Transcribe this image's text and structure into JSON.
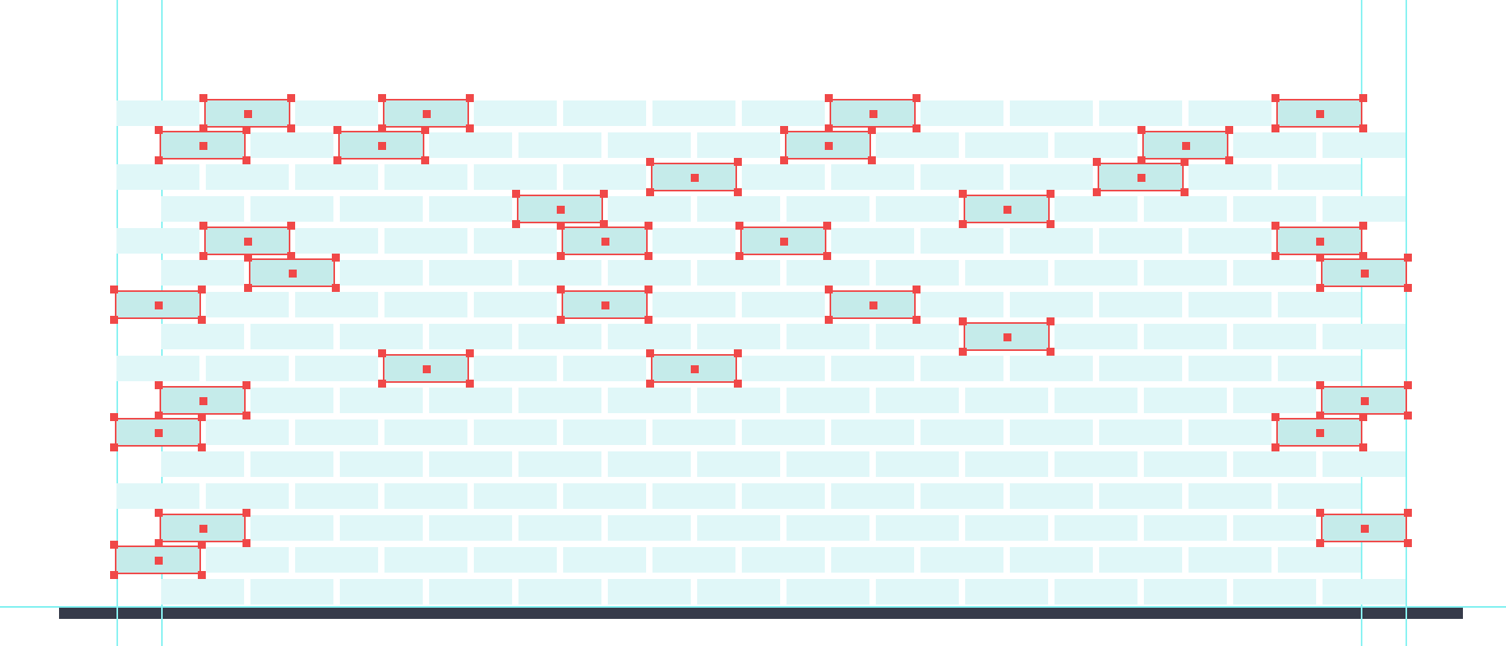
{
  "canvas": {
    "rows": [
      {
        "bricks": [
          {
            "selected": false
          },
          {
            "selected": true
          },
          {
            "selected": false
          },
          {
            "selected": true
          },
          {
            "selected": false
          },
          {
            "selected": false
          },
          {
            "selected": false
          },
          {
            "selected": false
          },
          {
            "selected": true
          },
          {
            "selected": false
          },
          {
            "selected": false
          },
          {
            "selected": false
          },
          {
            "selected": false
          },
          {
            "selected": true
          }
        ]
      },
      {
        "bricks": [
          {
            "selected": true
          },
          {
            "selected": false
          },
          {
            "selected": true
          },
          {
            "selected": false
          },
          {
            "selected": false
          },
          {
            "selected": false
          },
          {
            "selected": false
          },
          {
            "selected": true
          },
          {
            "selected": false
          },
          {
            "selected": false
          },
          {
            "selected": false
          },
          {
            "selected": true
          },
          {
            "selected": false
          },
          {
            "selected": false
          }
        ]
      },
      {
        "bricks": [
          {
            "selected": false
          },
          {
            "selected": false
          },
          {
            "selected": false
          },
          {
            "selected": false
          },
          {
            "selected": false
          },
          {
            "selected": false
          },
          {
            "selected": true
          },
          {
            "selected": false
          },
          {
            "selected": false
          },
          {
            "selected": false
          },
          {
            "selected": false
          },
          {
            "selected": true
          },
          {
            "selected": false
          },
          {
            "selected": false
          }
        ]
      },
      {
        "bricks": [
          {
            "selected": false
          },
          {
            "selected": false
          },
          {
            "selected": false
          },
          {
            "selected": false
          },
          {
            "selected": true
          },
          {
            "selected": false
          },
          {
            "selected": false
          },
          {
            "selected": false
          },
          {
            "selected": false
          },
          {
            "selected": true
          },
          {
            "selected": false
          },
          {
            "selected": false
          },
          {
            "selected": false
          },
          {
            "selected": false
          }
        ]
      },
      {
        "bricks": [
          {
            "selected": false
          },
          {
            "selected": true
          },
          {
            "selected": false
          },
          {
            "selected": false
          },
          {
            "selected": false
          },
          {
            "selected": true
          },
          {
            "selected": false
          },
          {
            "selected": true
          },
          {
            "selected": false
          },
          {
            "selected": false
          },
          {
            "selected": false
          },
          {
            "selected": false
          },
          {
            "selected": false
          },
          {
            "selected": true
          }
        ]
      },
      {
        "bricks": [
          {
            "selected": false
          },
          {
            "selected": true
          },
          {
            "selected": false
          },
          {
            "selected": false
          },
          {
            "selected": false
          },
          {
            "selected": false
          },
          {
            "selected": false
          },
          {
            "selected": false
          },
          {
            "selected": false
          },
          {
            "selected": false
          },
          {
            "selected": false
          },
          {
            "selected": false
          },
          {
            "selected": false
          },
          {
            "selected": true
          }
        ]
      },
      {
        "bricks": [
          {
            "selected": true
          },
          {
            "selected": false
          },
          {
            "selected": false
          },
          {
            "selected": false
          },
          {
            "selected": false
          },
          {
            "selected": true
          },
          {
            "selected": false
          },
          {
            "selected": false
          },
          {
            "selected": true
          },
          {
            "selected": false
          },
          {
            "selected": false
          },
          {
            "selected": false
          },
          {
            "selected": false
          },
          {
            "selected": false
          }
        ]
      },
      {
        "bricks": [
          {
            "selected": false
          },
          {
            "selected": false
          },
          {
            "selected": false
          },
          {
            "selected": false
          },
          {
            "selected": false
          },
          {
            "selected": false
          },
          {
            "selected": false
          },
          {
            "selected": false
          },
          {
            "selected": false
          },
          {
            "selected": true
          },
          {
            "selected": false
          },
          {
            "selected": false
          },
          {
            "selected": false
          },
          {
            "selected": false
          }
        ]
      },
      {
        "bricks": [
          {
            "selected": false
          },
          {
            "selected": false
          },
          {
            "selected": false
          },
          {
            "selected": true
          },
          {
            "selected": false
          },
          {
            "selected": false
          },
          {
            "selected": true
          },
          {
            "selected": false
          },
          {
            "selected": false
          },
          {
            "selected": false
          },
          {
            "selected": false
          },
          {
            "selected": false
          },
          {
            "selected": false
          },
          {
            "selected": false
          }
        ]
      },
      {
        "bricks": [
          {
            "selected": true
          },
          {
            "selected": false
          },
          {
            "selected": false
          },
          {
            "selected": false
          },
          {
            "selected": false
          },
          {
            "selected": false
          },
          {
            "selected": false
          },
          {
            "selected": false
          },
          {
            "selected": false
          },
          {
            "selected": false
          },
          {
            "selected": false
          },
          {
            "selected": false
          },
          {
            "selected": false
          },
          {
            "selected": true
          }
        ]
      },
      {
        "bricks": [
          {
            "selected": true
          },
          {
            "selected": false
          },
          {
            "selected": false
          },
          {
            "selected": false
          },
          {
            "selected": false
          },
          {
            "selected": false
          },
          {
            "selected": false
          },
          {
            "selected": false
          },
          {
            "selected": false
          },
          {
            "selected": false
          },
          {
            "selected": false
          },
          {
            "selected": false
          },
          {
            "selected": false
          },
          {
            "selected": true
          }
        ]
      },
      {
        "bricks": [
          {
            "selected": false
          },
          {
            "selected": false
          },
          {
            "selected": false
          },
          {
            "selected": false
          },
          {
            "selected": false
          },
          {
            "selected": false
          },
          {
            "selected": false
          },
          {
            "selected": false
          },
          {
            "selected": false
          },
          {
            "selected": false
          },
          {
            "selected": false
          },
          {
            "selected": false
          },
          {
            "selected": false
          },
          {
            "selected": false
          }
        ]
      },
      {
        "bricks": [
          {
            "selected": false
          },
          {
            "selected": false
          },
          {
            "selected": false
          },
          {
            "selected": false
          },
          {
            "selected": false
          },
          {
            "selected": false
          },
          {
            "selected": false
          },
          {
            "selected": false
          },
          {
            "selected": false
          },
          {
            "selected": false
          },
          {
            "selected": false
          },
          {
            "selected": false
          },
          {
            "selected": false
          },
          {
            "selected": false
          }
        ]
      },
      {
        "bricks": [
          {
            "selected": true
          },
          {
            "selected": false
          },
          {
            "selected": false
          },
          {
            "selected": false
          },
          {
            "selected": false
          },
          {
            "selected": false
          },
          {
            "selected": false
          },
          {
            "selected": false
          },
          {
            "selected": false
          },
          {
            "selected": false
          },
          {
            "selected": false
          },
          {
            "selected": false
          },
          {
            "selected": false
          },
          {
            "selected": true
          }
        ]
      },
      {
        "bricks": [
          {
            "selected": true
          },
          {
            "selected": false
          },
          {
            "selected": false
          },
          {
            "selected": false
          },
          {
            "selected": false
          },
          {
            "selected": false
          },
          {
            "selected": false
          },
          {
            "selected": false
          },
          {
            "selected": false
          },
          {
            "selected": false
          },
          {
            "selected": false
          },
          {
            "selected": false
          },
          {
            "selected": false
          },
          {
            "selected": false
          }
        ]
      },
      {
        "bricks": [
          {
            "selected": false
          },
          {
            "selected": false
          },
          {
            "selected": false
          },
          {
            "selected": false
          },
          {
            "selected": false
          },
          {
            "selected": false
          },
          {
            "selected": false
          },
          {
            "selected": false
          },
          {
            "selected": false
          },
          {
            "selected": false
          },
          {
            "selected": false
          },
          {
            "selected": false
          },
          {
            "selected": false
          },
          {
            "selected": false
          }
        ]
      }
    ]
  }
}
